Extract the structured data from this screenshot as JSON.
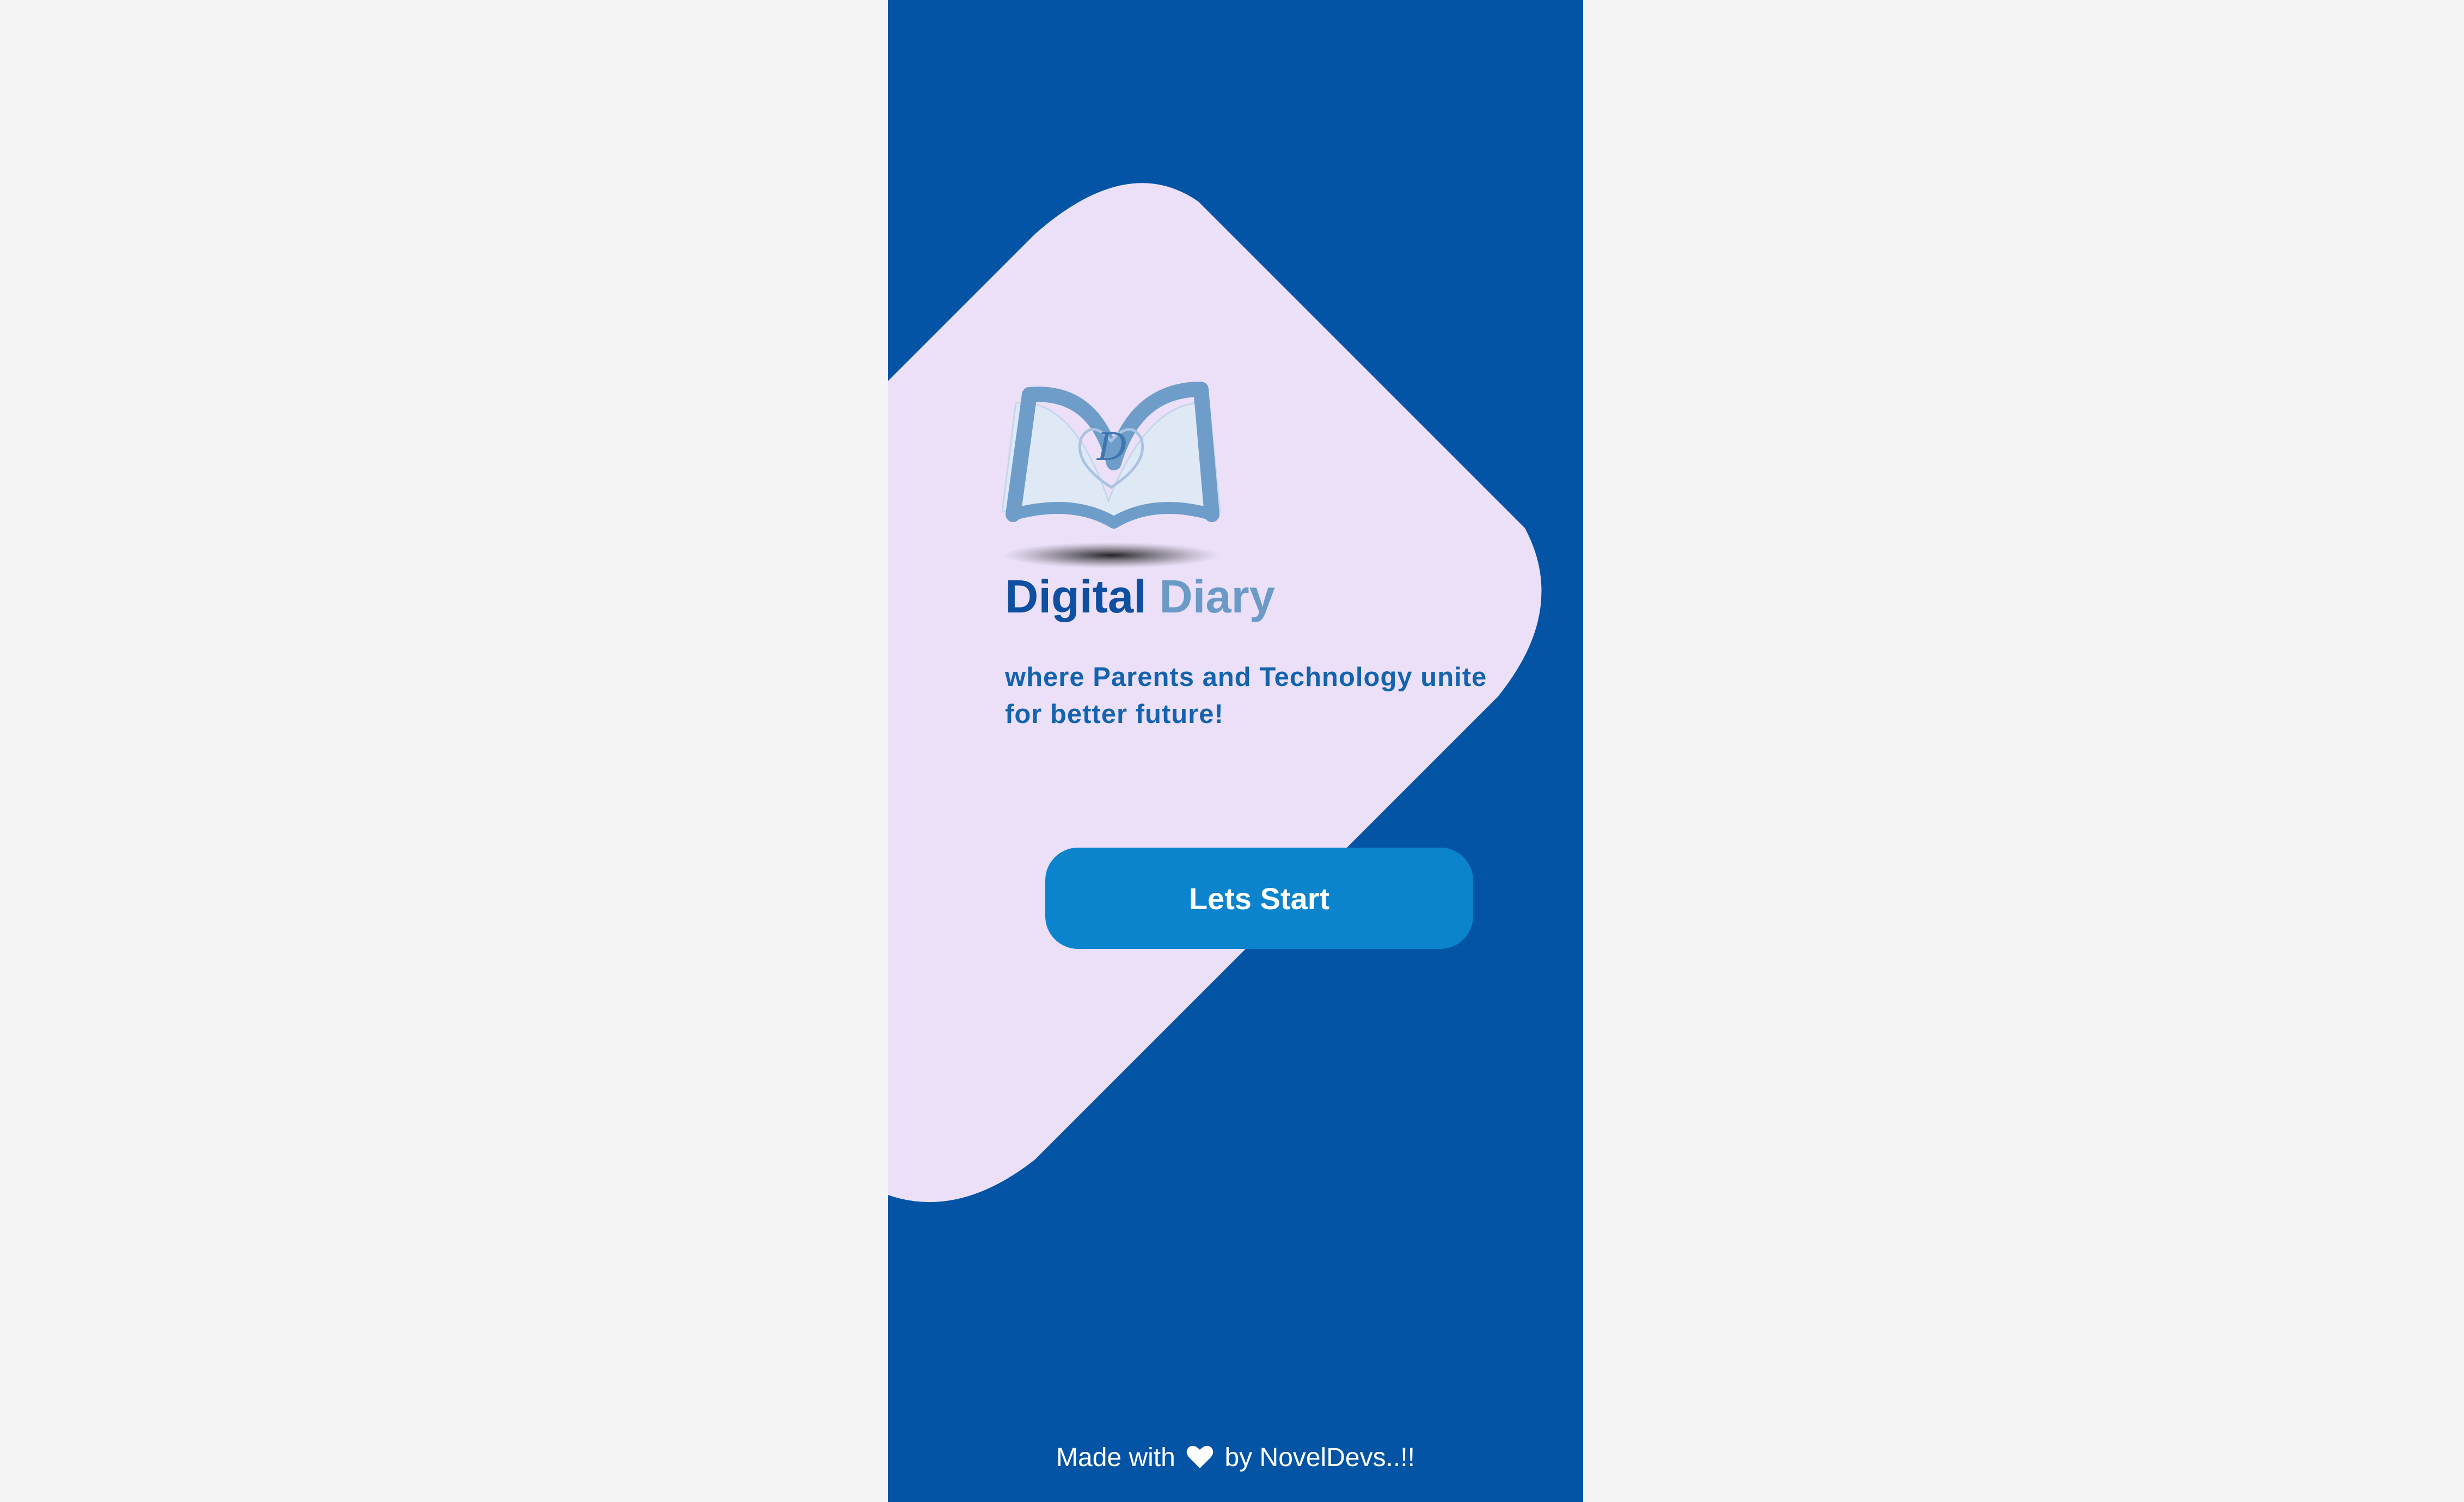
{
  "app": {
    "title_part1": "Digital",
    "title_part2": "Diary",
    "tagline_line1": "where Parents and Technology unite",
    "tagline_line2": "for better future!",
    "logo_letter": "D"
  },
  "actions": {
    "start_label": "Lets Start"
  },
  "footer": {
    "prefix": "Made with",
    "icon": "heart-icon",
    "suffix": "by NovelDevs..!!"
  },
  "colors": {
    "background": "#0454a6",
    "card": "#ebe0f8",
    "button": "#0b84cd",
    "title_primary": "#0f4fa0",
    "title_secondary": "#6b9ac6"
  }
}
